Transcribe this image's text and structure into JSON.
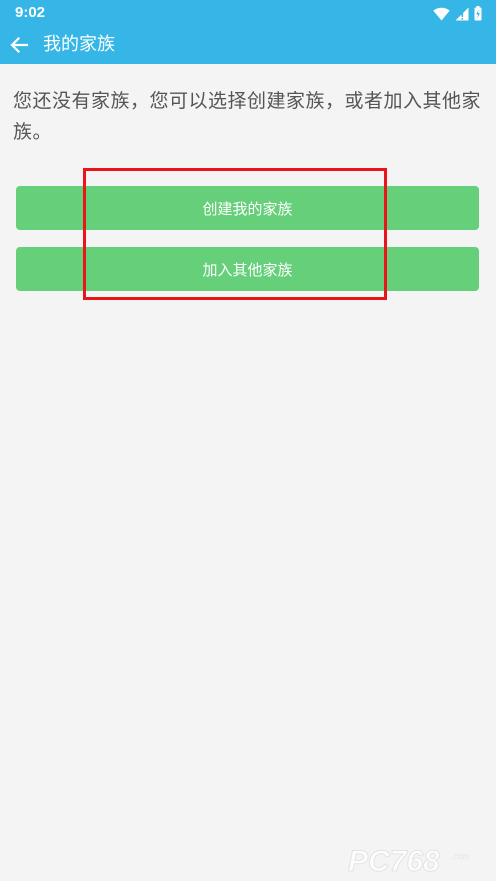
{
  "status_bar": {
    "time": "9:02",
    "icons": [
      "wifi-icon",
      "signal-icon",
      "battery-icon"
    ],
    "background": "#35b6e6"
  },
  "app_bar": {
    "title": "我的家族",
    "back_icon": "arrow-left-icon",
    "background": "#35b6e6"
  },
  "main": {
    "message": "您还没有家族，您可以选择创建家族，或者加入其他家族。",
    "buttons": [
      {
        "label": "创建我的家族"
      },
      {
        "label": "加入其他家族"
      }
    ],
    "button_color": "#66cf7a",
    "highlight_color": "#e8151b"
  },
  "watermark": {
    "text": "PC768"
  }
}
